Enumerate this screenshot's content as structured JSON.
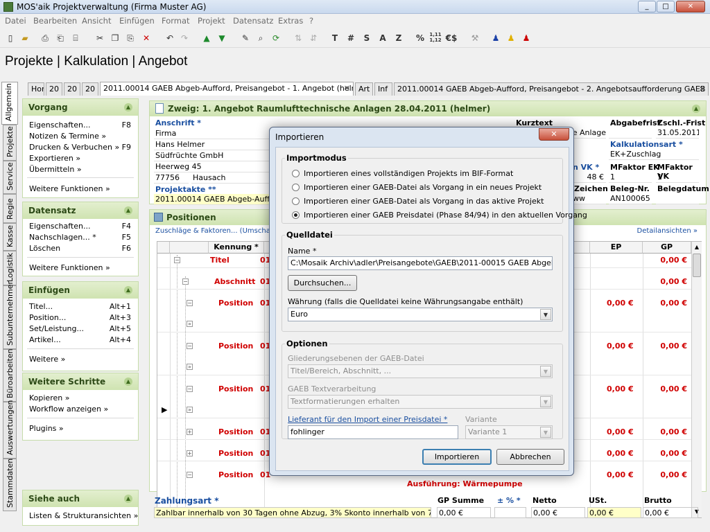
{
  "window": {
    "title": "MOS'aik Projektverwaltung (Firma Muster AG)",
    "min": "_",
    "max": "□",
    "close": "✕"
  },
  "menu": [
    "Datei",
    "Bearbeiten",
    "Ansicht",
    "Einfügen",
    "Format",
    "Projekt",
    "Datensatz",
    "Extras",
    "?"
  ],
  "toolbar": {
    "t": "T",
    "hash": "#",
    "s": "S",
    "a": "A",
    "z": "Z",
    "percent": "%",
    "num": "1,11\n1,12",
    "euro": "€$"
  },
  "breadcrumb": "Projekte | Kalkulation | Angebot",
  "left_tabs": [
    "Allgemein",
    "Projekte",
    "Service",
    "Regie",
    "Kasse",
    "Logistik",
    "Subunternehmer",
    "Büroarbeiten",
    "Auswertungen",
    "Stammdaten"
  ],
  "doc_tabs": [
    "Hor",
    "20",
    "20",
    "20",
    "2011.00014 GAEB Abgeb-Aufford, Preisangebot - 1. Angebot (helmer)",
    "Art",
    "Inf",
    "2011.00014 GAEB Abgeb-Aufford, Preisangebot - 2. Angebotsaufforderung GAEB (helmer)"
  ],
  "tab_close": "✕",
  "sidebar": {
    "vorgang": {
      "title": "Vorgang",
      "items": [
        [
          "Eigenschaften...",
          "F8"
        ],
        [
          "Notizen & Termine »",
          ""
        ],
        [
          "Drucken & Verbuchen »",
          "F9"
        ],
        [
          "Exportieren »",
          ""
        ],
        [
          "Übermitteln »",
          ""
        ]
      ],
      "more": "Weitere Funktionen »"
    },
    "datensatz": {
      "title": "Datensatz",
      "items": [
        [
          "Eigenschaften...",
          "F4"
        ],
        [
          "Nachschlagen... *",
          "F5"
        ],
        [
          "Löschen",
          "F6"
        ]
      ],
      "more": "Weitere Funktionen »"
    },
    "einfuegen": {
      "title": "Einfügen",
      "items": [
        [
          "Titel...",
          "Alt+1"
        ],
        [
          "Position...",
          "Alt+3"
        ],
        [
          "Set/Leistung...",
          "Alt+5"
        ],
        [
          "Artikel...",
          "Alt+4"
        ]
      ],
      "more": "Weitere »"
    },
    "schritte": {
      "title": "Weitere Schritte",
      "items": [
        "Kopieren »",
        "Workflow anzeigen »"
      ],
      "plugins": "Plugins »"
    },
    "siehe": {
      "title": "Siehe auch",
      "items": [
        "Listen & Strukturansichten »"
      ]
    }
  },
  "zweig": {
    "title": "Zweig: 1. Angebot Raumlufttechnische Anlagen 28.04.2011 (helmer)",
    "anschrift_label": "Anschrift *",
    "anschrift": [
      "Firma",
      "Hans Helmer",
      "Südfrüchte GmbH",
      "Heerweg 45"
    ],
    "plz": "77756",
    "ort": "Hausach",
    "projektakte_label": "Projektakte **",
    "projektakte": "2011.00014 GAEB Abgeb-Aufford,",
    "kurztext_label": "Kurztext",
    "kurztext_partial": "he Anlage",
    "abgabefrist_label": "Abgabefrist",
    "zschl_label": "Zschl.-Frist",
    "zschl_value": "31.05.2011",
    "kalkart_label": "Kalkulationsart *",
    "kalkart_value": "EK+Zuschlag",
    "vk_label": "n VK *",
    "vk_value": "48 €",
    "mfaktor_ek_label": "MFaktor EK",
    "mfaktor_ek": "1",
    "mfaktor_vk_label": "MFaktor VK",
    "mfaktor_vk": "1",
    "zeichen_label": "Zeichen",
    "zeichen_value": "ww",
    "belegnr_label": "Beleg-Nr.",
    "belegnr": "AN100065",
    "belegdatum_label": "Belegdatum"
  },
  "positionen": {
    "title": "Positionen",
    "link_left": "Zuschläge & Faktoren... (Umschalt+F8)",
    "link_right": "Detailansichten »",
    "headers": {
      "kennung": "Kennung *",
      "ep": "EP",
      "gp": "GP"
    },
    "rows": [
      {
        "type": "Titel",
        "nr": "01",
        "gp": "0,00 €"
      },
      {
        "type": "Abschnitt",
        "nr": "01",
        "gp": "0,00 €"
      },
      {
        "type": "Position",
        "nr": "01",
        "ep": "0,00 €",
        "gp": "0,00 €"
      },
      {
        "type": "Position",
        "nr": "01",
        "ep": "0,00 €",
        "gp": "0,00 €"
      },
      {
        "type": "Position",
        "nr": "01",
        "ep": "0,00 €",
        "gp": "0,00 €"
      },
      {
        "type": "Position",
        "nr": "01",
        "ep": "0,00 €",
        "gp": "0,00 €"
      },
      {
        "type": "Position",
        "nr": "01",
        "ep": "0,00 €",
        "gp": "0,00 €"
      },
      {
        "type": "Position",
        "nr": "01",
        "ep": "0,00 €",
        "gp": "0,00 €"
      }
    ],
    "last_text": "Ausführung: Wärmepumpe"
  },
  "footer": {
    "zahlungsart_label": "Zahlungsart *",
    "zahlungsart": "Zahlbar innerhalb von 30 Tagen ohne Abzug, 3% Skonto innerhalb von 7 Tagen",
    "gp_summe_label": "GP Summe",
    "gp_summe": "0,00 €",
    "pm_label": "± % *",
    "netto_label": "Netto",
    "netto": "0,00 €",
    "ust_label": "USt.",
    "ust": "0,00 €",
    "brutto_label": "Brutto",
    "brutto": "0,00 €"
  },
  "dialog": {
    "title": "Importieren",
    "importmodus_label": "Importmodus",
    "options": [
      "Importieren eines vollständigen Projekts im BIF-Format",
      "Importieren einer GAEB-Datei als Vorgang in ein neues Projekt",
      "Importieren einer GAEB-Datei als Vorgang in das aktive Projekt",
      "Importieren einer GAEB Preisdatei (Phase 84/94) in den aktuellen Vorgang"
    ],
    "selected_option": 3,
    "quelldatei_label": "Quelldatei",
    "name_label": "Name *",
    "name_value": "C:\\Mosaik Archiv\\adler\\Preisangebote\\GAEB\\2011-00015 GAEB Abgeb-Aufford",
    "browse_button": "Durchsuchen...",
    "waehrung_label": "Währung (falls die Quelldatei keine Währungsangabe enthält)",
    "waehrung_value": "Euro",
    "optionen_label": "Optionen",
    "gliederung_label": "Gliederungsebenen der GAEB-Datei",
    "gliederung_value": "Titel/Bereich, Abschnitt, ...",
    "text_label": "GAEB Textverarbeitung",
    "text_value": "Textformatierungen erhalten",
    "lieferant_label": "Lieferant für den Import einer Preisdatei *",
    "lieferant_value": "fohlinger",
    "variante_label": "Variante",
    "variante_value": "Variante 1",
    "import_button": "Importieren",
    "cancel_button": "Abbrechen"
  }
}
